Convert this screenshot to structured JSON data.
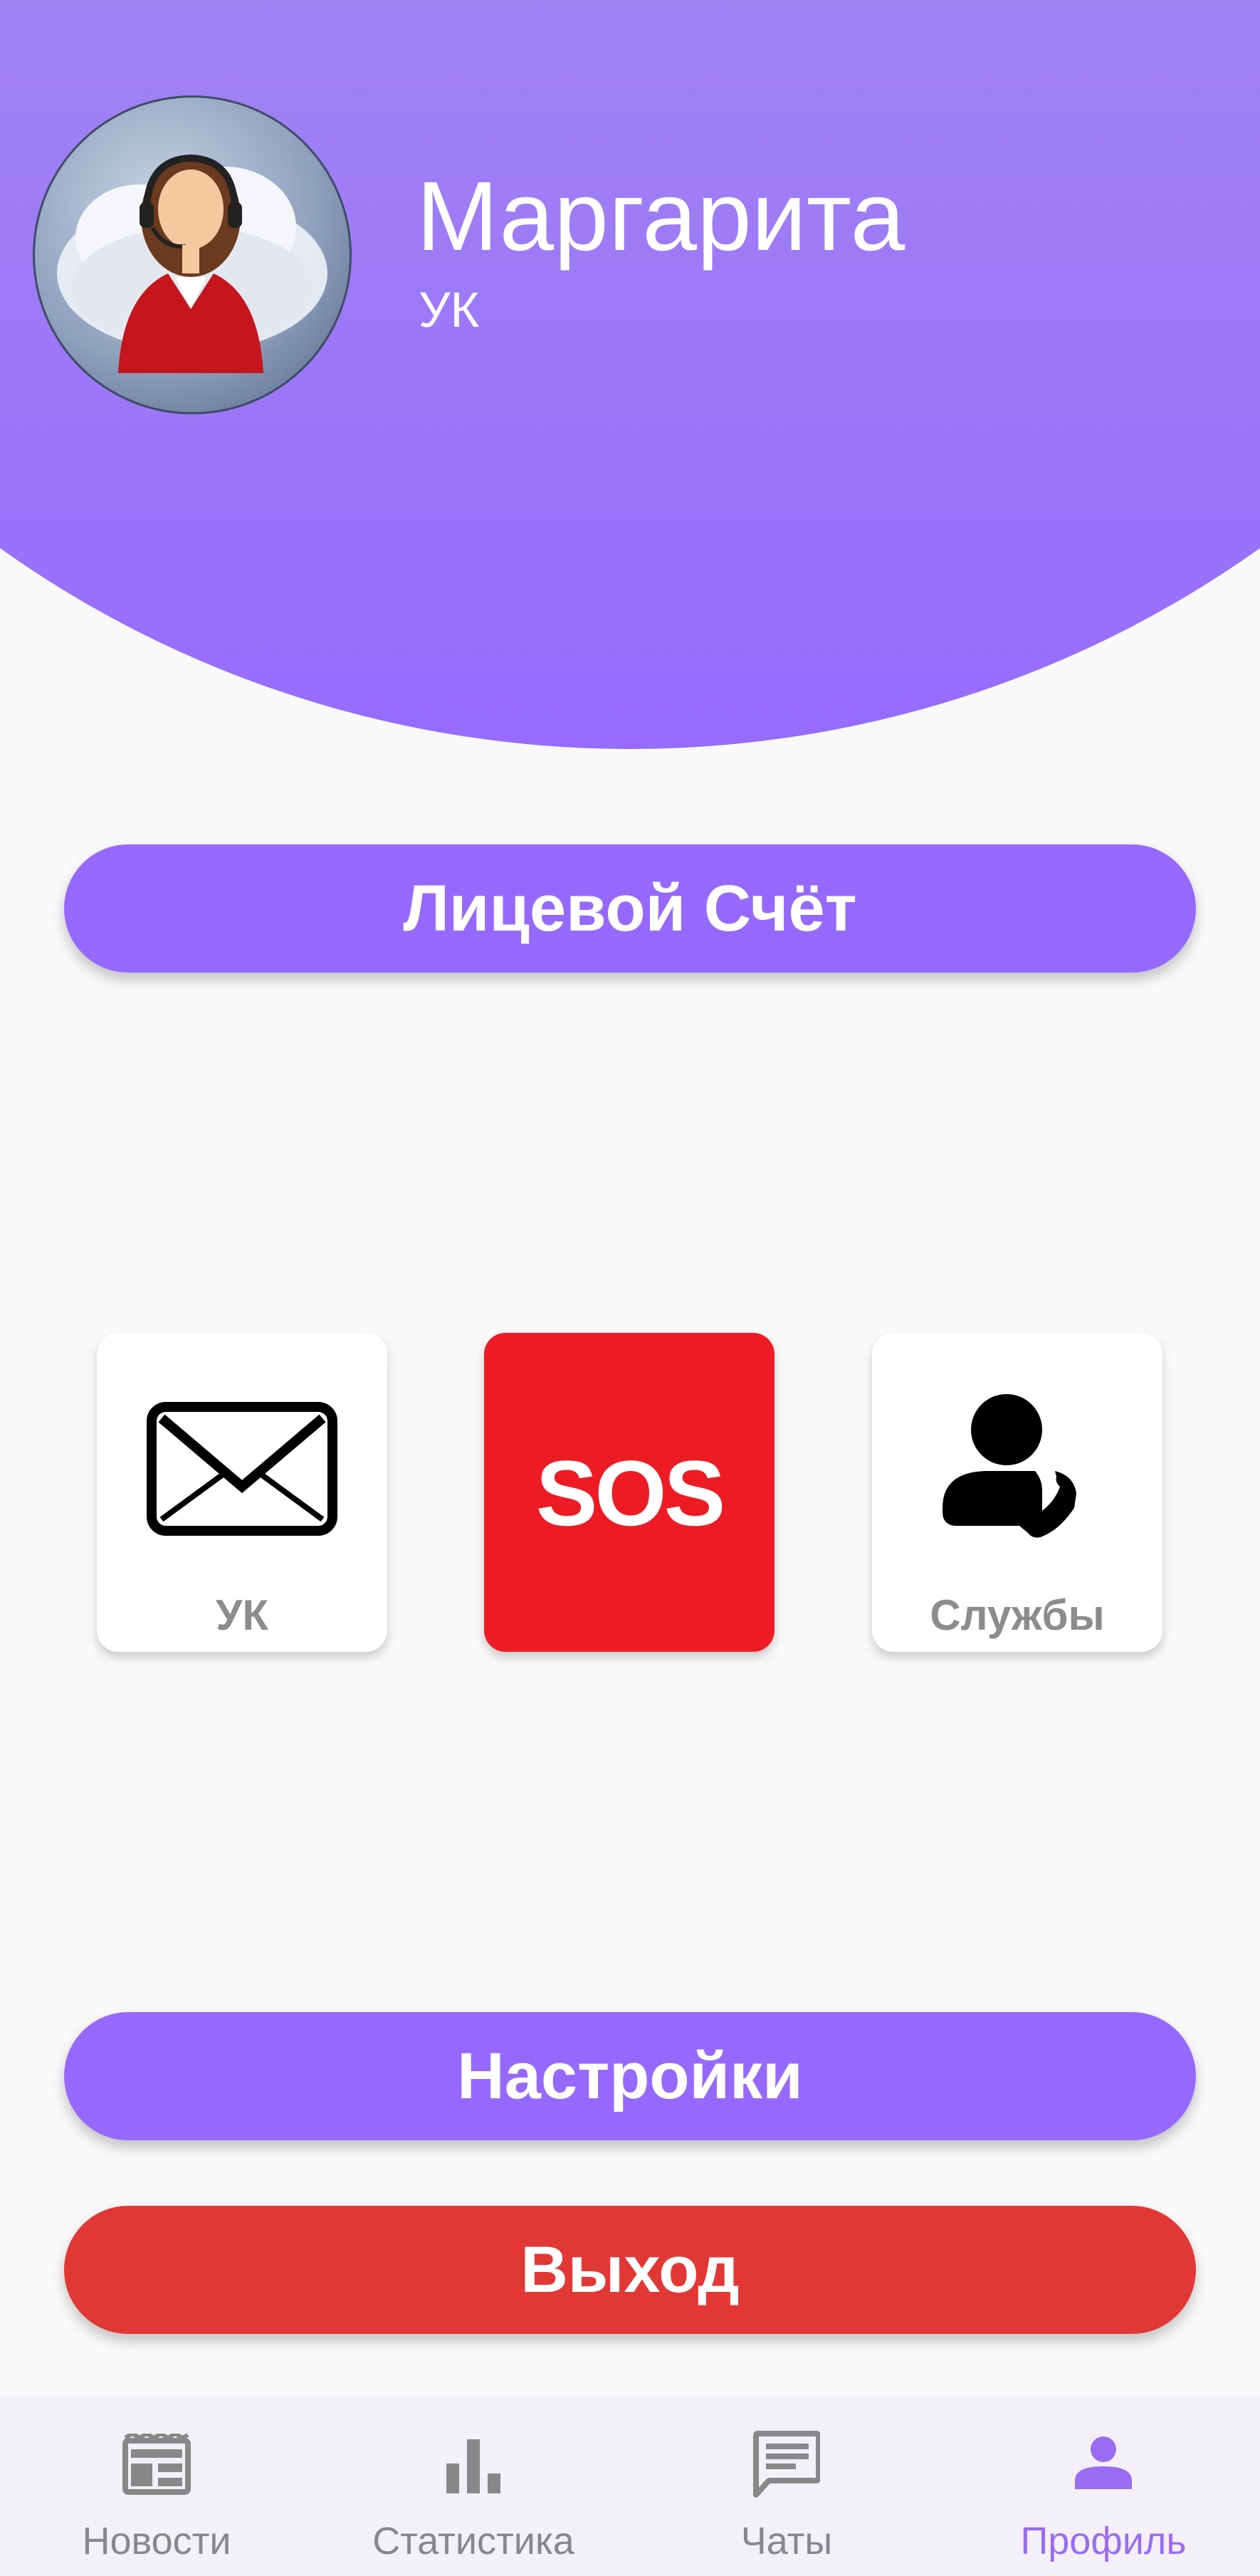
{
  "profile": {
    "name": "Маргарита",
    "role": "УК"
  },
  "buttons": {
    "account": "Лицевой Счёт",
    "settings": "Настройки",
    "logout": "Выход"
  },
  "tiles": {
    "mail_label": "УК",
    "sos_text": "SOS",
    "services_label": "Службы"
  },
  "nav": [
    {
      "label": "Новости",
      "icon": "news-icon",
      "active": false
    },
    {
      "label": "Статистика",
      "icon": "bar-chart-icon",
      "active": false
    },
    {
      "label": "Чаты",
      "icon": "chat-icon",
      "active": false
    },
    {
      "label": "Профиль",
      "icon": "person-icon",
      "active": true
    }
  ],
  "colors": {
    "accent": "#9669fd",
    "danger": "#e23835",
    "sos": "#ed1c24",
    "nav_active": "#9a6cf3"
  }
}
